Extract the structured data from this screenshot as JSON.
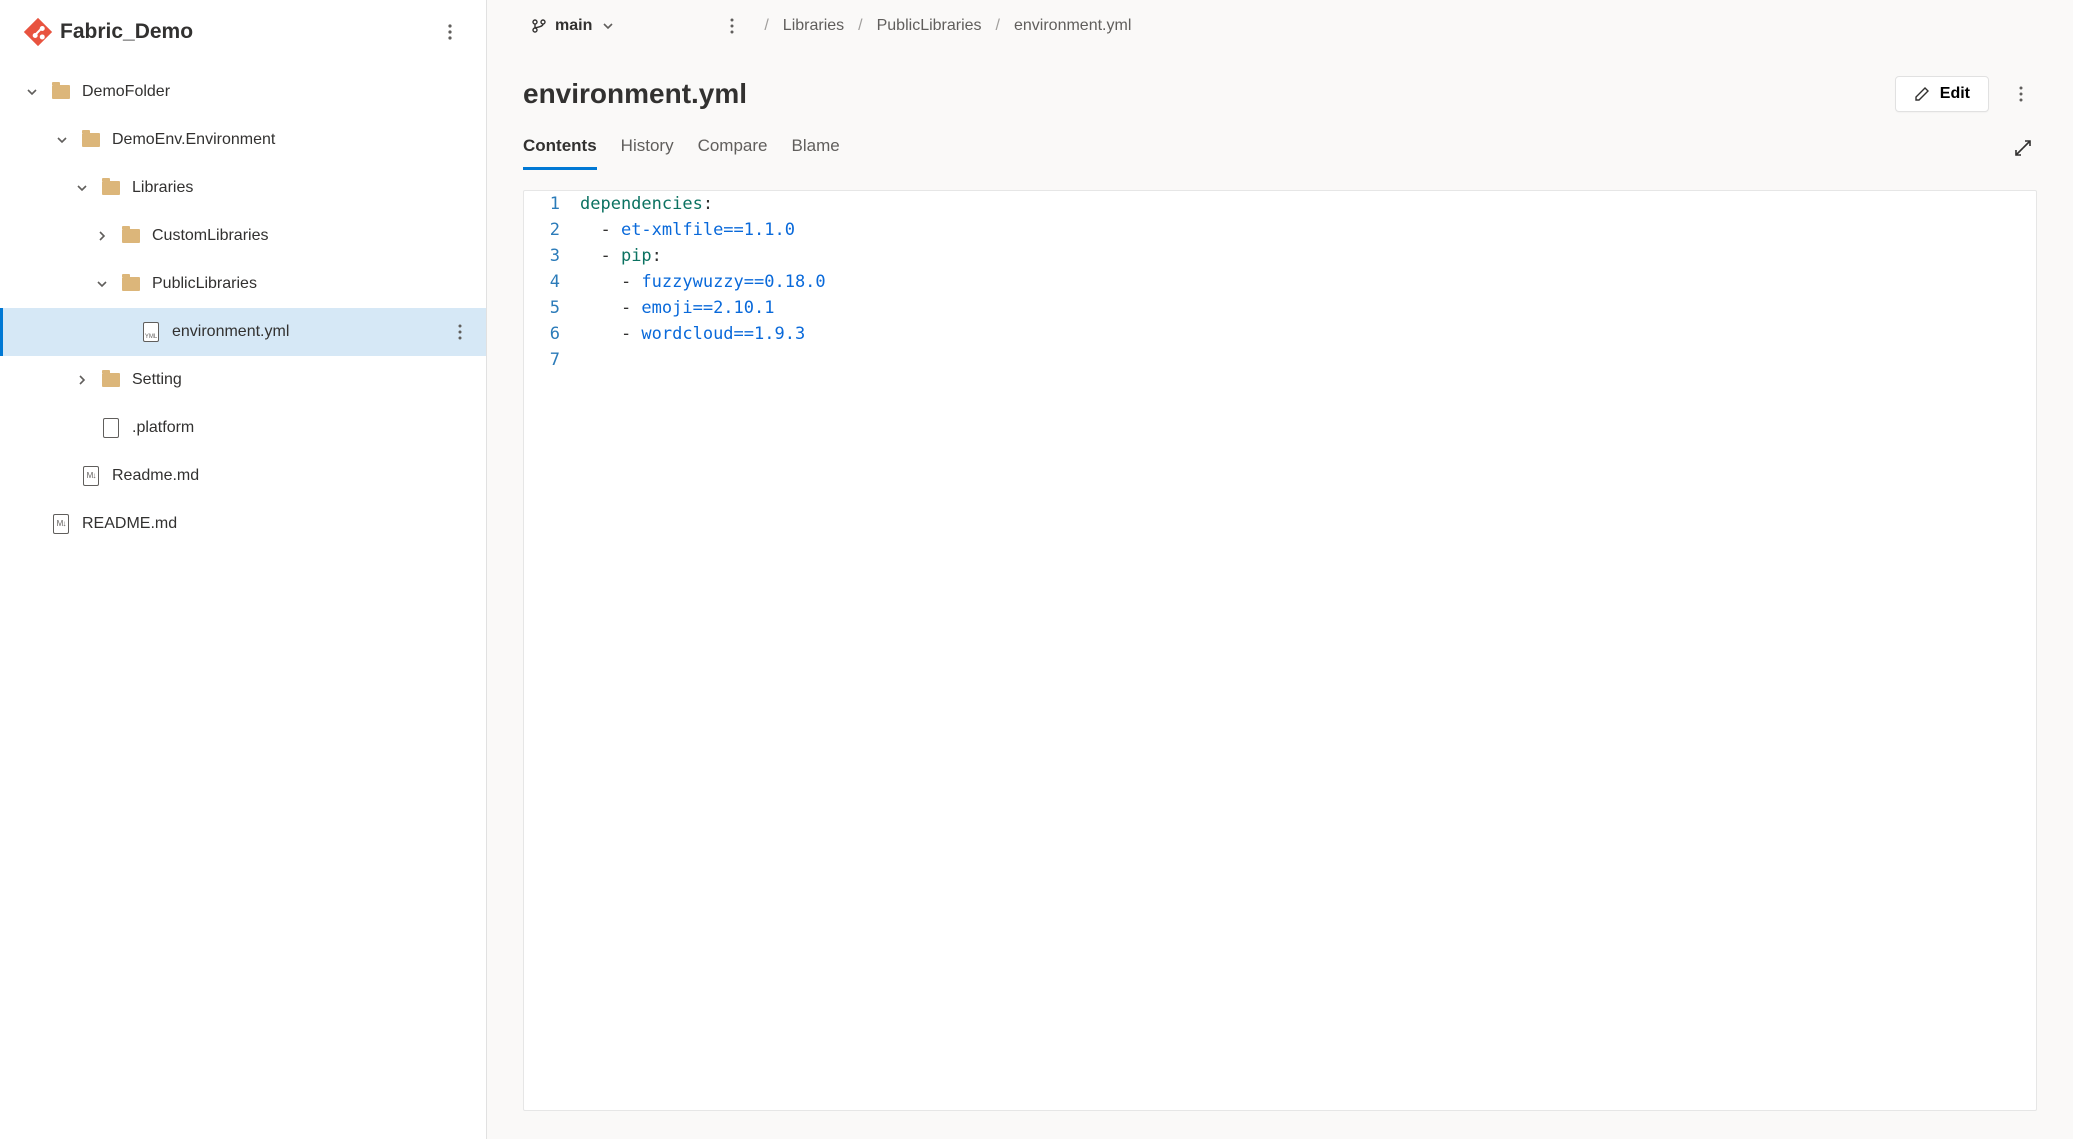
{
  "repo": {
    "name": "Fabric_Demo"
  },
  "tree": {
    "demoFolder": "DemoFolder",
    "demoEnv": "DemoEnv.Environment",
    "libraries": "Libraries",
    "customLibraries": "CustomLibraries",
    "publicLibraries": "PublicLibraries",
    "environmentYml": "environment.yml",
    "setting": "Setting",
    "platform": ".platform",
    "readmeLower": "Readme.md",
    "readmeUpper": "README.md"
  },
  "branch": {
    "name": "main"
  },
  "breadcrumbs": {
    "c0": "Libraries",
    "c1": "PublicLibraries",
    "c2": "environment.yml"
  },
  "file": {
    "title": "environment.yml"
  },
  "actions": {
    "edit": "Edit"
  },
  "tabs": {
    "contents": "Contents",
    "history": "History",
    "compare": "Compare",
    "blame": "Blame"
  },
  "code": {
    "ln1": "1",
    "ln2": "2",
    "ln3": "3",
    "ln4": "4",
    "ln5": "5",
    "ln6": "6",
    "ln7": "7",
    "l1_key": "dependencies",
    "l1_colon": ":",
    "l2_dash": "  - ",
    "l2_pkg": "et-xmlfile==1.1.0",
    "l3_dash": "  - ",
    "l3_key": "pip",
    "l3_colon": ":",
    "l4_dash": "    - ",
    "l4_pkg": "fuzzywuzzy==0.18.0",
    "l5_dash": "    - ",
    "l5_pkg": "emoji==2.10.1",
    "l6_dash": "    - ",
    "l6_pkg": "wordcloud==1.9.3"
  }
}
